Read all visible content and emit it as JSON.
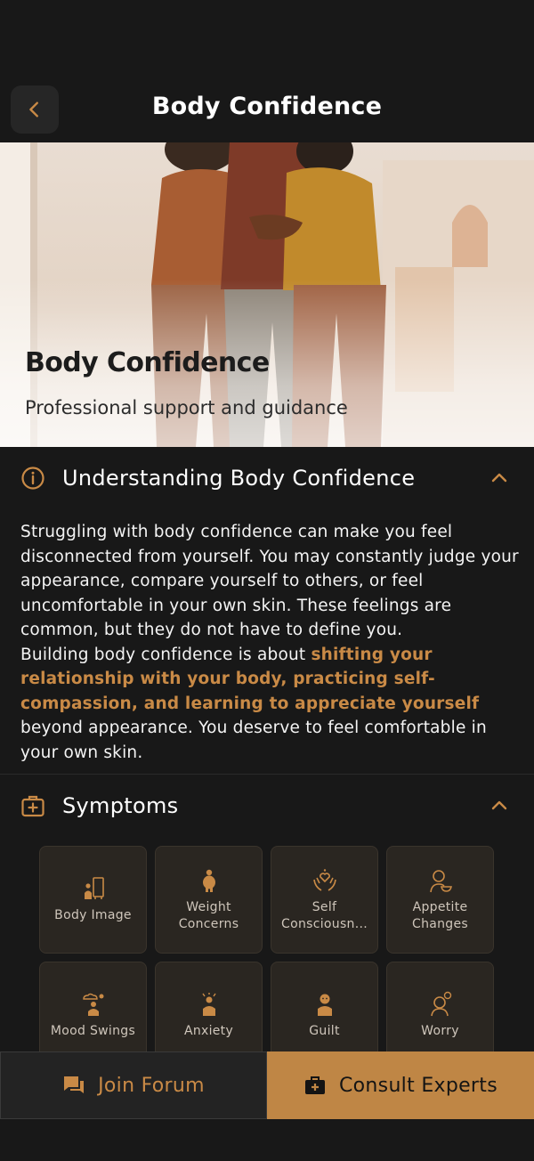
{
  "header": {
    "title": "Body Confidence"
  },
  "hero": {
    "title": "Body Confidence",
    "subtitle": "Professional support and guidance"
  },
  "understanding": {
    "title": "Understanding Body Confidence",
    "paragraph1": "Struggling with body confidence can make you feel disconnected from yourself. You may constantly judge your appearance, compare yourself to others, or feel uncomfortable in your own skin. These feelings are common, but they do not have to define you.",
    "paragraph2_start": "Building body confidence is about ",
    "paragraph2_highlight": "shifting your relationship with your body, practicing self-compassion, and learning to appreciate yourself",
    "paragraph2_end": " beyond appearance. You deserve to feel comfortable in your own skin."
  },
  "symptoms": {
    "title": "Symptoms",
    "items": [
      {
        "label": "Body Image",
        "icon": "mirror-person-icon"
      },
      {
        "label": "Weight Concerns",
        "icon": "person-weight-icon"
      },
      {
        "label": "Self Consciousn...",
        "icon": "hands-heart-icon"
      },
      {
        "label": "Appetite Changes",
        "icon": "person-bowl-icon"
      },
      {
        "label": "Mood Swings",
        "icon": "mood-cloud-icon"
      },
      {
        "label": "Anxiety",
        "icon": "anxious-person-icon"
      },
      {
        "label": "Guilt",
        "icon": "guilt-person-icon"
      },
      {
        "label": "Worry",
        "icon": "worried-person-icon"
      }
    ]
  },
  "actions": {
    "forum_label": "Join Forum",
    "consult_label": "Consult Experts"
  },
  "colors": {
    "accent": "#c98a46",
    "background": "#181818",
    "card": "#2a2621"
  }
}
